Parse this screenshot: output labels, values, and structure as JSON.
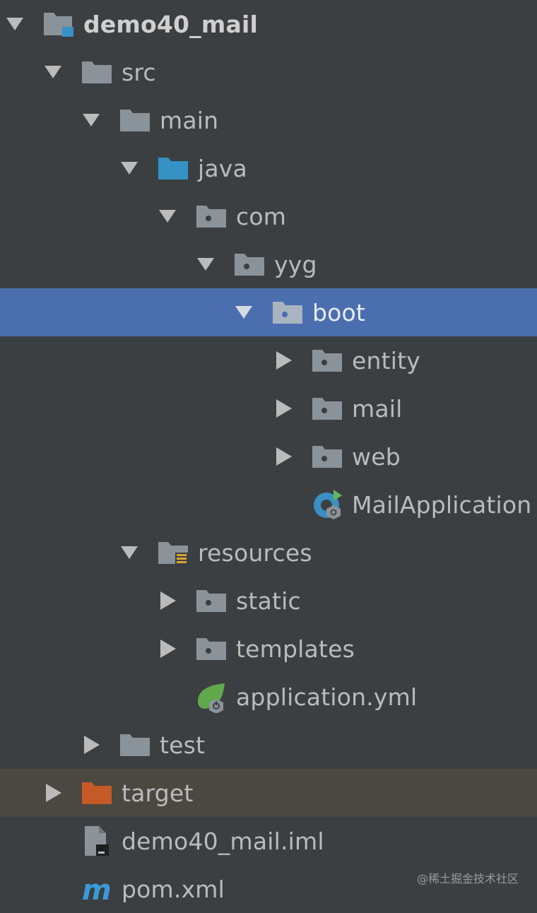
{
  "tree": {
    "root": {
      "label": "demo40_mail",
      "expanded": true,
      "icon": "module-folder-icon"
    },
    "items": [
      {
        "label": "src",
        "expanded": true,
        "icon": "folder-icon"
      },
      {
        "label": "main",
        "expanded": true,
        "icon": "folder-icon"
      },
      {
        "label": "java",
        "expanded": true,
        "icon": "source-root-folder-icon",
        "color": "#3592c4"
      },
      {
        "label": "com",
        "expanded": true,
        "icon": "package-icon"
      },
      {
        "label": "yyg",
        "expanded": true,
        "icon": "package-icon"
      },
      {
        "label": "boot",
        "expanded": true,
        "icon": "package-icon",
        "selected": true
      },
      {
        "label": "entity",
        "expanded": false,
        "icon": "package-icon"
      },
      {
        "label": "mail",
        "expanded": false,
        "icon": "package-icon"
      },
      {
        "label": "web",
        "expanded": false,
        "icon": "package-icon"
      },
      {
        "label": "MailApplication",
        "icon": "spring-boot-class-icon"
      },
      {
        "label": "resources",
        "expanded": true,
        "icon": "resources-root-folder-icon"
      },
      {
        "label": "static",
        "expanded": false,
        "icon": "package-icon"
      },
      {
        "label": "templates",
        "expanded": false,
        "icon": "package-icon"
      },
      {
        "label": "application.yml",
        "icon": "spring-config-icon"
      },
      {
        "label": "test",
        "expanded": false,
        "icon": "folder-icon"
      },
      {
        "label": "target",
        "expanded": false,
        "icon": "excluded-folder-icon",
        "color": "#c55a26"
      },
      {
        "label": "demo40_mail.iml",
        "icon": "iml-file-icon"
      },
      {
        "label": "pom.xml",
        "icon": "maven-file-icon"
      }
    ]
  },
  "watermark": "@稀土掘金技术社区",
  "colors": {
    "background": "#3c3f41",
    "selection": "#4b6eaf",
    "excluded_row": "#4a4840",
    "text": "#bbbbbb"
  }
}
